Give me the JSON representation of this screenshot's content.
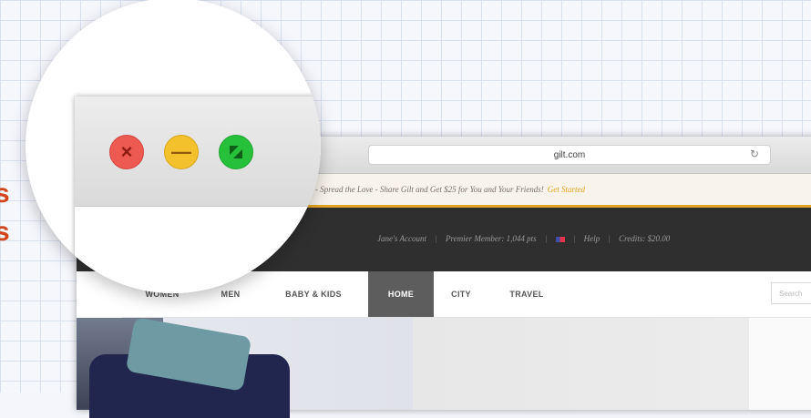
{
  "side_text": {
    "line1": "s",
    "line2": "s"
  },
  "browser": {
    "address": "gilt.com",
    "promo": {
      "message": "- Spread the Love - Share Gilt and Get $25 for You and Your Friends!",
      "cta": "Get Started"
    },
    "account": {
      "account_link": "Jane's Account",
      "member_status": "Premier Member: 1,044 pts",
      "help": "Help",
      "credits": "Credits: $20.00",
      "separator": "|"
    },
    "nav": {
      "items": [
        {
          "label": "WOMEN"
        },
        {
          "label": "MEN"
        },
        {
          "label": "BABY & KIDS"
        },
        {
          "label": "HOME",
          "active": true
        },
        {
          "label": "CITY"
        },
        {
          "label": "TRAVEL"
        }
      ],
      "search_placeholder": "Search"
    }
  },
  "window_controls": {
    "close": "×",
    "minimize": "—"
  },
  "colors": {
    "accent_text": "#d2461e",
    "promo_border": "#e0a524",
    "close": "#ec5a52",
    "minimize": "#f3c12c",
    "maximize": "#27c03b"
  }
}
